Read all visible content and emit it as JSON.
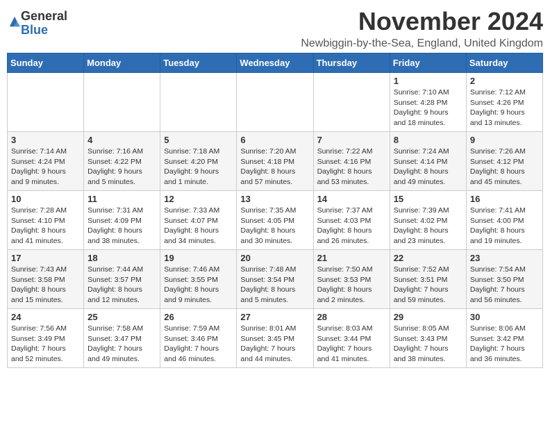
{
  "header": {
    "logo_general": "General",
    "logo_blue": "Blue",
    "month_title": "November 2024",
    "location": "Newbiggin-by-the-Sea, England, United Kingdom"
  },
  "days_of_week": [
    "Sunday",
    "Monday",
    "Tuesday",
    "Wednesday",
    "Thursday",
    "Friday",
    "Saturday"
  ],
  "weeks": [
    [
      {
        "day": "",
        "info": ""
      },
      {
        "day": "",
        "info": ""
      },
      {
        "day": "",
        "info": ""
      },
      {
        "day": "",
        "info": ""
      },
      {
        "day": "",
        "info": ""
      },
      {
        "day": "1",
        "info": "Sunrise: 7:10 AM\nSunset: 4:28 PM\nDaylight: 9 hours\nand 18 minutes."
      },
      {
        "day": "2",
        "info": "Sunrise: 7:12 AM\nSunset: 4:26 PM\nDaylight: 9 hours\nand 13 minutes."
      }
    ],
    [
      {
        "day": "3",
        "info": "Sunrise: 7:14 AM\nSunset: 4:24 PM\nDaylight: 9 hours\nand 9 minutes."
      },
      {
        "day": "4",
        "info": "Sunrise: 7:16 AM\nSunset: 4:22 PM\nDaylight: 9 hours\nand 5 minutes."
      },
      {
        "day": "5",
        "info": "Sunrise: 7:18 AM\nSunset: 4:20 PM\nDaylight: 9 hours\nand 1 minute."
      },
      {
        "day": "6",
        "info": "Sunrise: 7:20 AM\nSunset: 4:18 PM\nDaylight: 8 hours\nand 57 minutes."
      },
      {
        "day": "7",
        "info": "Sunrise: 7:22 AM\nSunset: 4:16 PM\nDaylight: 8 hours\nand 53 minutes."
      },
      {
        "day": "8",
        "info": "Sunrise: 7:24 AM\nSunset: 4:14 PM\nDaylight: 8 hours\nand 49 minutes."
      },
      {
        "day": "9",
        "info": "Sunrise: 7:26 AM\nSunset: 4:12 PM\nDaylight: 8 hours\nand 45 minutes."
      }
    ],
    [
      {
        "day": "10",
        "info": "Sunrise: 7:28 AM\nSunset: 4:10 PM\nDaylight: 8 hours\nand 41 minutes."
      },
      {
        "day": "11",
        "info": "Sunrise: 7:31 AM\nSunset: 4:09 PM\nDaylight: 8 hours\nand 38 minutes."
      },
      {
        "day": "12",
        "info": "Sunrise: 7:33 AM\nSunset: 4:07 PM\nDaylight: 8 hours\nand 34 minutes."
      },
      {
        "day": "13",
        "info": "Sunrise: 7:35 AM\nSunset: 4:05 PM\nDaylight: 8 hours\nand 30 minutes."
      },
      {
        "day": "14",
        "info": "Sunrise: 7:37 AM\nSunset: 4:03 PM\nDaylight: 8 hours\nand 26 minutes."
      },
      {
        "day": "15",
        "info": "Sunrise: 7:39 AM\nSunset: 4:02 PM\nDaylight: 8 hours\nand 23 minutes."
      },
      {
        "day": "16",
        "info": "Sunrise: 7:41 AM\nSunset: 4:00 PM\nDaylight: 8 hours\nand 19 minutes."
      }
    ],
    [
      {
        "day": "17",
        "info": "Sunrise: 7:43 AM\nSunset: 3:58 PM\nDaylight: 8 hours\nand 15 minutes."
      },
      {
        "day": "18",
        "info": "Sunrise: 7:44 AM\nSunset: 3:57 PM\nDaylight: 8 hours\nand 12 minutes."
      },
      {
        "day": "19",
        "info": "Sunrise: 7:46 AM\nSunset: 3:55 PM\nDaylight: 8 hours\nand 9 minutes."
      },
      {
        "day": "20",
        "info": "Sunrise: 7:48 AM\nSunset: 3:54 PM\nDaylight: 8 hours\nand 5 minutes."
      },
      {
        "day": "21",
        "info": "Sunrise: 7:50 AM\nSunset: 3:53 PM\nDaylight: 8 hours\nand 2 minutes."
      },
      {
        "day": "22",
        "info": "Sunrise: 7:52 AM\nSunset: 3:51 PM\nDaylight: 7 hours\nand 59 minutes."
      },
      {
        "day": "23",
        "info": "Sunrise: 7:54 AM\nSunset: 3:50 PM\nDaylight: 7 hours\nand 56 minutes."
      }
    ],
    [
      {
        "day": "24",
        "info": "Sunrise: 7:56 AM\nSunset: 3:49 PM\nDaylight: 7 hours\nand 52 minutes."
      },
      {
        "day": "25",
        "info": "Sunrise: 7:58 AM\nSunset: 3:47 PM\nDaylight: 7 hours\nand 49 minutes."
      },
      {
        "day": "26",
        "info": "Sunrise: 7:59 AM\nSunset: 3:46 PM\nDaylight: 7 hours\nand 46 minutes."
      },
      {
        "day": "27",
        "info": "Sunrise: 8:01 AM\nSunset: 3:45 PM\nDaylight: 7 hours\nand 44 minutes."
      },
      {
        "day": "28",
        "info": "Sunrise: 8:03 AM\nSunset: 3:44 PM\nDaylight: 7 hours\nand 41 minutes."
      },
      {
        "day": "29",
        "info": "Sunrise: 8:05 AM\nSunset: 3:43 PM\nDaylight: 7 hours\nand 38 minutes."
      },
      {
        "day": "30",
        "info": "Sunrise: 8:06 AM\nSunset: 3:42 PM\nDaylight: 7 hours\nand 36 minutes."
      }
    ]
  ]
}
